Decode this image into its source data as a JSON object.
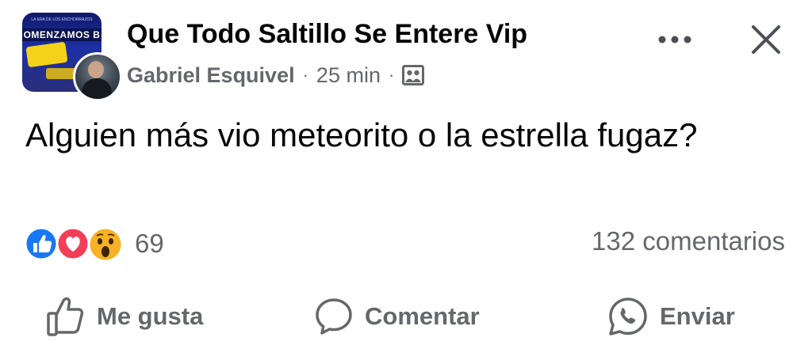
{
  "post": {
    "group_name": "Que Todo Saltillo Se Entere Vip",
    "author": "Gabriel Esquivel",
    "time": "25 min",
    "separator": "·",
    "text": "Alguien más vio meteorito o la estrella fugaz?",
    "group_avatar": {
      "banner_text": "OMENZAMOS B",
      "small_text": "LA ERA DE LOS ENCHORRAZOS"
    }
  },
  "reactions": {
    "count": "69",
    "types": [
      "like-icon",
      "love-icon",
      "wow-icon"
    ],
    "comments": "132 comentarios"
  },
  "actions": {
    "like": "Me gusta",
    "comment": "Comentar",
    "send": "Enviar"
  },
  "colors": {
    "like": "#1877f2",
    "love": "#f33e58",
    "wow": "#f7b125",
    "secondary_text": "#65676b",
    "primary_text": "#050505"
  }
}
